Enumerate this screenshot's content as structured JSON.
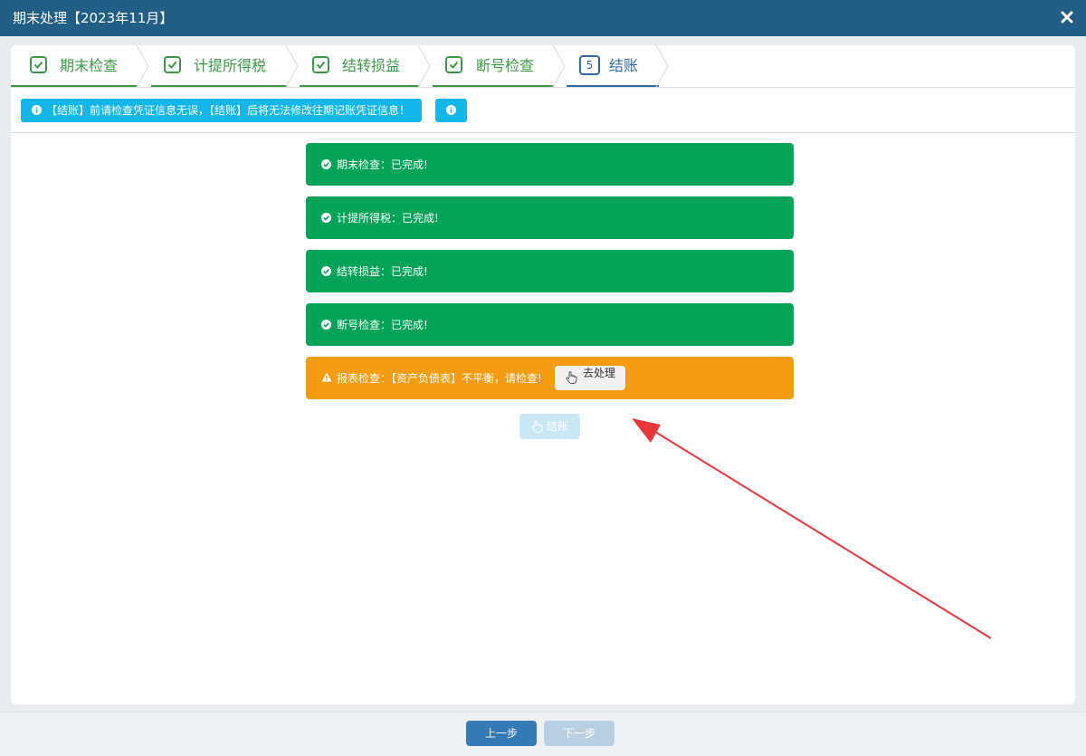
{
  "window": {
    "title": "期末处理【2023年11月】"
  },
  "steps": [
    {
      "label": "期末检查",
      "status": "done"
    },
    {
      "label": "计提所得税",
      "status": "done"
    },
    {
      "label": "结转损益",
      "status": "done"
    },
    {
      "label": "断号检查",
      "status": "done"
    },
    {
      "number": "5",
      "label": "结账",
      "status": "active"
    }
  ],
  "toolbar": {
    "notice": "【结账】前请检查凭证信息无误，【结账】后将无法修改往期记账凭证信息！"
  },
  "checks": [
    {
      "text": "期末检查：已完成!",
      "status": "success"
    },
    {
      "text": "计提所得税：已完成!",
      "status": "success"
    },
    {
      "text": "结转损益：已完成!",
      "status": "success"
    },
    {
      "text": "断号检查：已完成!",
      "status": "success"
    },
    {
      "text": "报表检查：【资产负债表】不平衡，请检查!",
      "status": "warning",
      "action_label": "去处理"
    }
  ],
  "actions": {
    "close_accounts_label": "结账"
  },
  "footer": {
    "prev_label": "上一步",
    "next_label": "下一步"
  },
  "colors": {
    "titlebar": "#205e86",
    "success": "#03a458",
    "warning": "#f39c12",
    "info": "#13b6e8",
    "step_done": "#3b9b45",
    "step_active": "#2e6da4",
    "annotation_arrow": "#e8383d"
  }
}
